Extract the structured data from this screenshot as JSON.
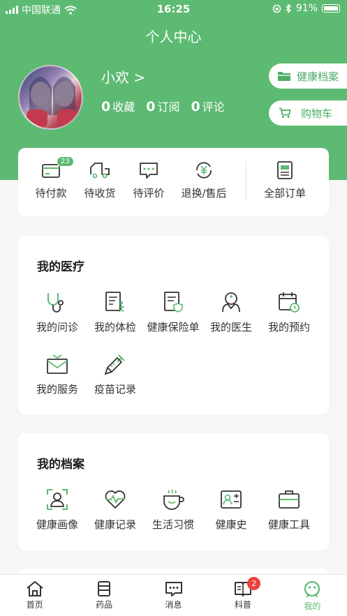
{
  "status_bar": {
    "carrier": "中国联通",
    "time": "16:25",
    "battery": "91%"
  },
  "page_title": "个人中心",
  "user": {
    "name": "小欢 >",
    "favorites_count": "0",
    "favorites_label": "收藏",
    "subscriptions_count": "0",
    "subscriptions_label": "订阅",
    "comments_count": "0",
    "comments_label": "评论"
  },
  "side_buttons": {
    "health_archive": "健康档案",
    "cart": "购物车"
  },
  "orders": {
    "items": [
      {
        "label": "待付款",
        "badge": "23",
        "icon": "wallet-icon"
      },
      {
        "label": "待收货",
        "icon": "truck-icon"
      },
      {
        "label": "待评价",
        "icon": "comment-icon"
      },
      {
        "label": "退换/售后",
        "icon": "yen-refresh-icon"
      }
    ],
    "all": {
      "label": "全部订单",
      "icon": "orders-list-icon"
    }
  },
  "medical": {
    "title": "我的医疗",
    "items": [
      {
        "label": "我的问诊",
        "icon": "stethoscope-icon"
      },
      {
        "label": "我的体检",
        "icon": "checkup-icon"
      },
      {
        "label": "健康保险单",
        "icon": "insurance-doc-icon"
      },
      {
        "label": "我的医生",
        "icon": "doctor-icon"
      },
      {
        "label": "我的预约",
        "icon": "calendar-clock-icon"
      },
      {
        "label": "我的服务",
        "icon": "service-envelope-icon"
      },
      {
        "label": "疫苗记录",
        "icon": "syringe-icon"
      }
    ]
  },
  "records": {
    "title": "我的档案",
    "items": [
      {
        "label": "健康画像",
        "icon": "profile-scan-icon"
      },
      {
        "label": "健康记录",
        "icon": "heart-pulse-icon"
      },
      {
        "label": "生活习惯",
        "icon": "coffee-cup-icon"
      },
      {
        "label": "健康史",
        "icon": "id-card-icon"
      },
      {
        "label": "健康工具",
        "icon": "toolbox-icon"
      }
    ]
  },
  "tabbar": {
    "items": [
      {
        "label": "首页",
        "icon": "home-icon"
      },
      {
        "label": "药品",
        "icon": "medicine-icon"
      },
      {
        "label": "消息",
        "icon": "message-icon"
      },
      {
        "label": "科普",
        "icon": "book-icon",
        "badge": "2"
      },
      {
        "label": "我的",
        "icon": "profile-face-icon",
        "active": true
      }
    ]
  },
  "colors": {
    "brand": "#5dba72",
    "badge_red": "#e9423b"
  }
}
